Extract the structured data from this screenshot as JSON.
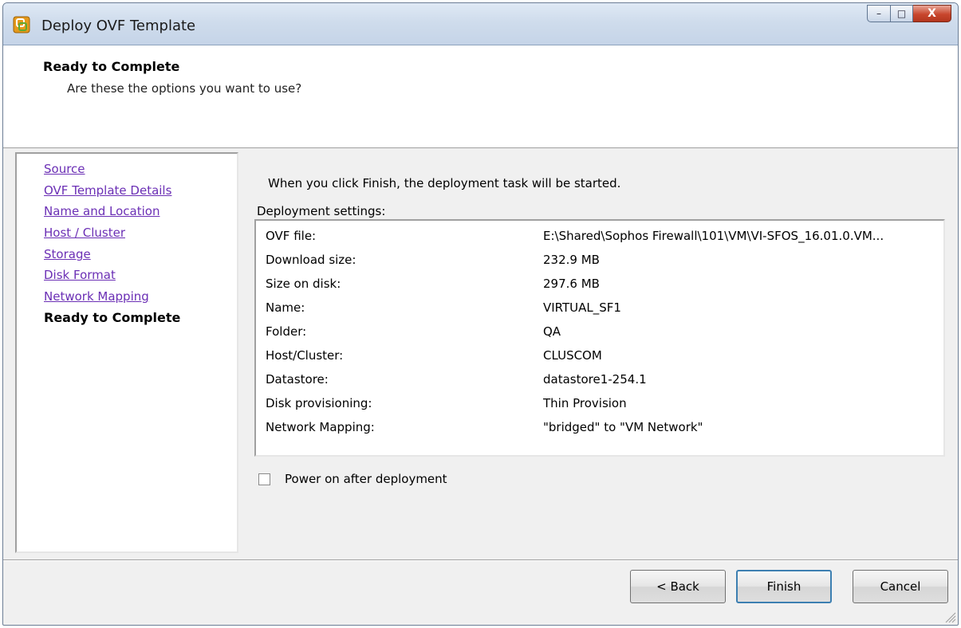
{
  "window": {
    "title": "Deploy OVF Template",
    "caption": {
      "minimize": "–",
      "maximize": "□",
      "close": "X"
    }
  },
  "header": {
    "title": "Ready to Complete",
    "subtitle": "Are these the options you want to use?"
  },
  "nav": {
    "items": [
      {
        "label": "Source"
      },
      {
        "label": "OVF Template Details"
      },
      {
        "label": "Name and Location"
      },
      {
        "label": "Host / Cluster"
      },
      {
        "label": "Storage"
      },
      {
        "label": "Disk Format"
      },
      {
        "label": "Network Mapping"
      },
      {
        "label": "Ready to Complete"
      }
    ],
    "current": "Ready to Complete"
  },
  "main": {
    "intro": "When you click Finish, the deployment task will be started.",
    "settings_label": "Deployment settings:",
    "settings": [
      {
        "key": "OVF file:",
        "value": "E:\\Shared\\Sophos Firewall\\101\\VM\\VI-SFOS_16.01.0.VM..."
      },
      {
        "key": "Download size:",
        "value": "232.9 MB"
      },
      {
        "key": "Size on disk:",
        "value": "297.6 MB"
      },
      {
        "key": "Name:",
        "value": "VIRTUAL_SF1"
      },
      {
        "key": "Folder:",
        "value": "QA"
      },
      {
        "key": "Host/Cluster:",
        "value": "CLUSCOM"
      },
      {
        "key": "Datastore:",
        "value": "datastore1-254.1"
      },
      {
        "key": "Disk provisioning:",
        "value": "Thin Provision"
      },
      {
        "key": "Network Mapping:",
        "value": "\"bridged\" to \"VM Network\""
      }
    ],
    "power_on_label": "Power on after deployment",
    "power_on_checked": false
  },
  "footer": {
    "back_label": "< Back",
    "finish_label": "Finish",
    "cancel_label": "Cancel"
  },
  "colors": {
    "link": "#6b2fb5",
    "close_button": "#c8462d",
    "finish_focus": "#3c7fb1"
  },
  "icons": {
    "app": "vsphere-app-icon",
    "resize": "resize-grip-icon"
  }
}
